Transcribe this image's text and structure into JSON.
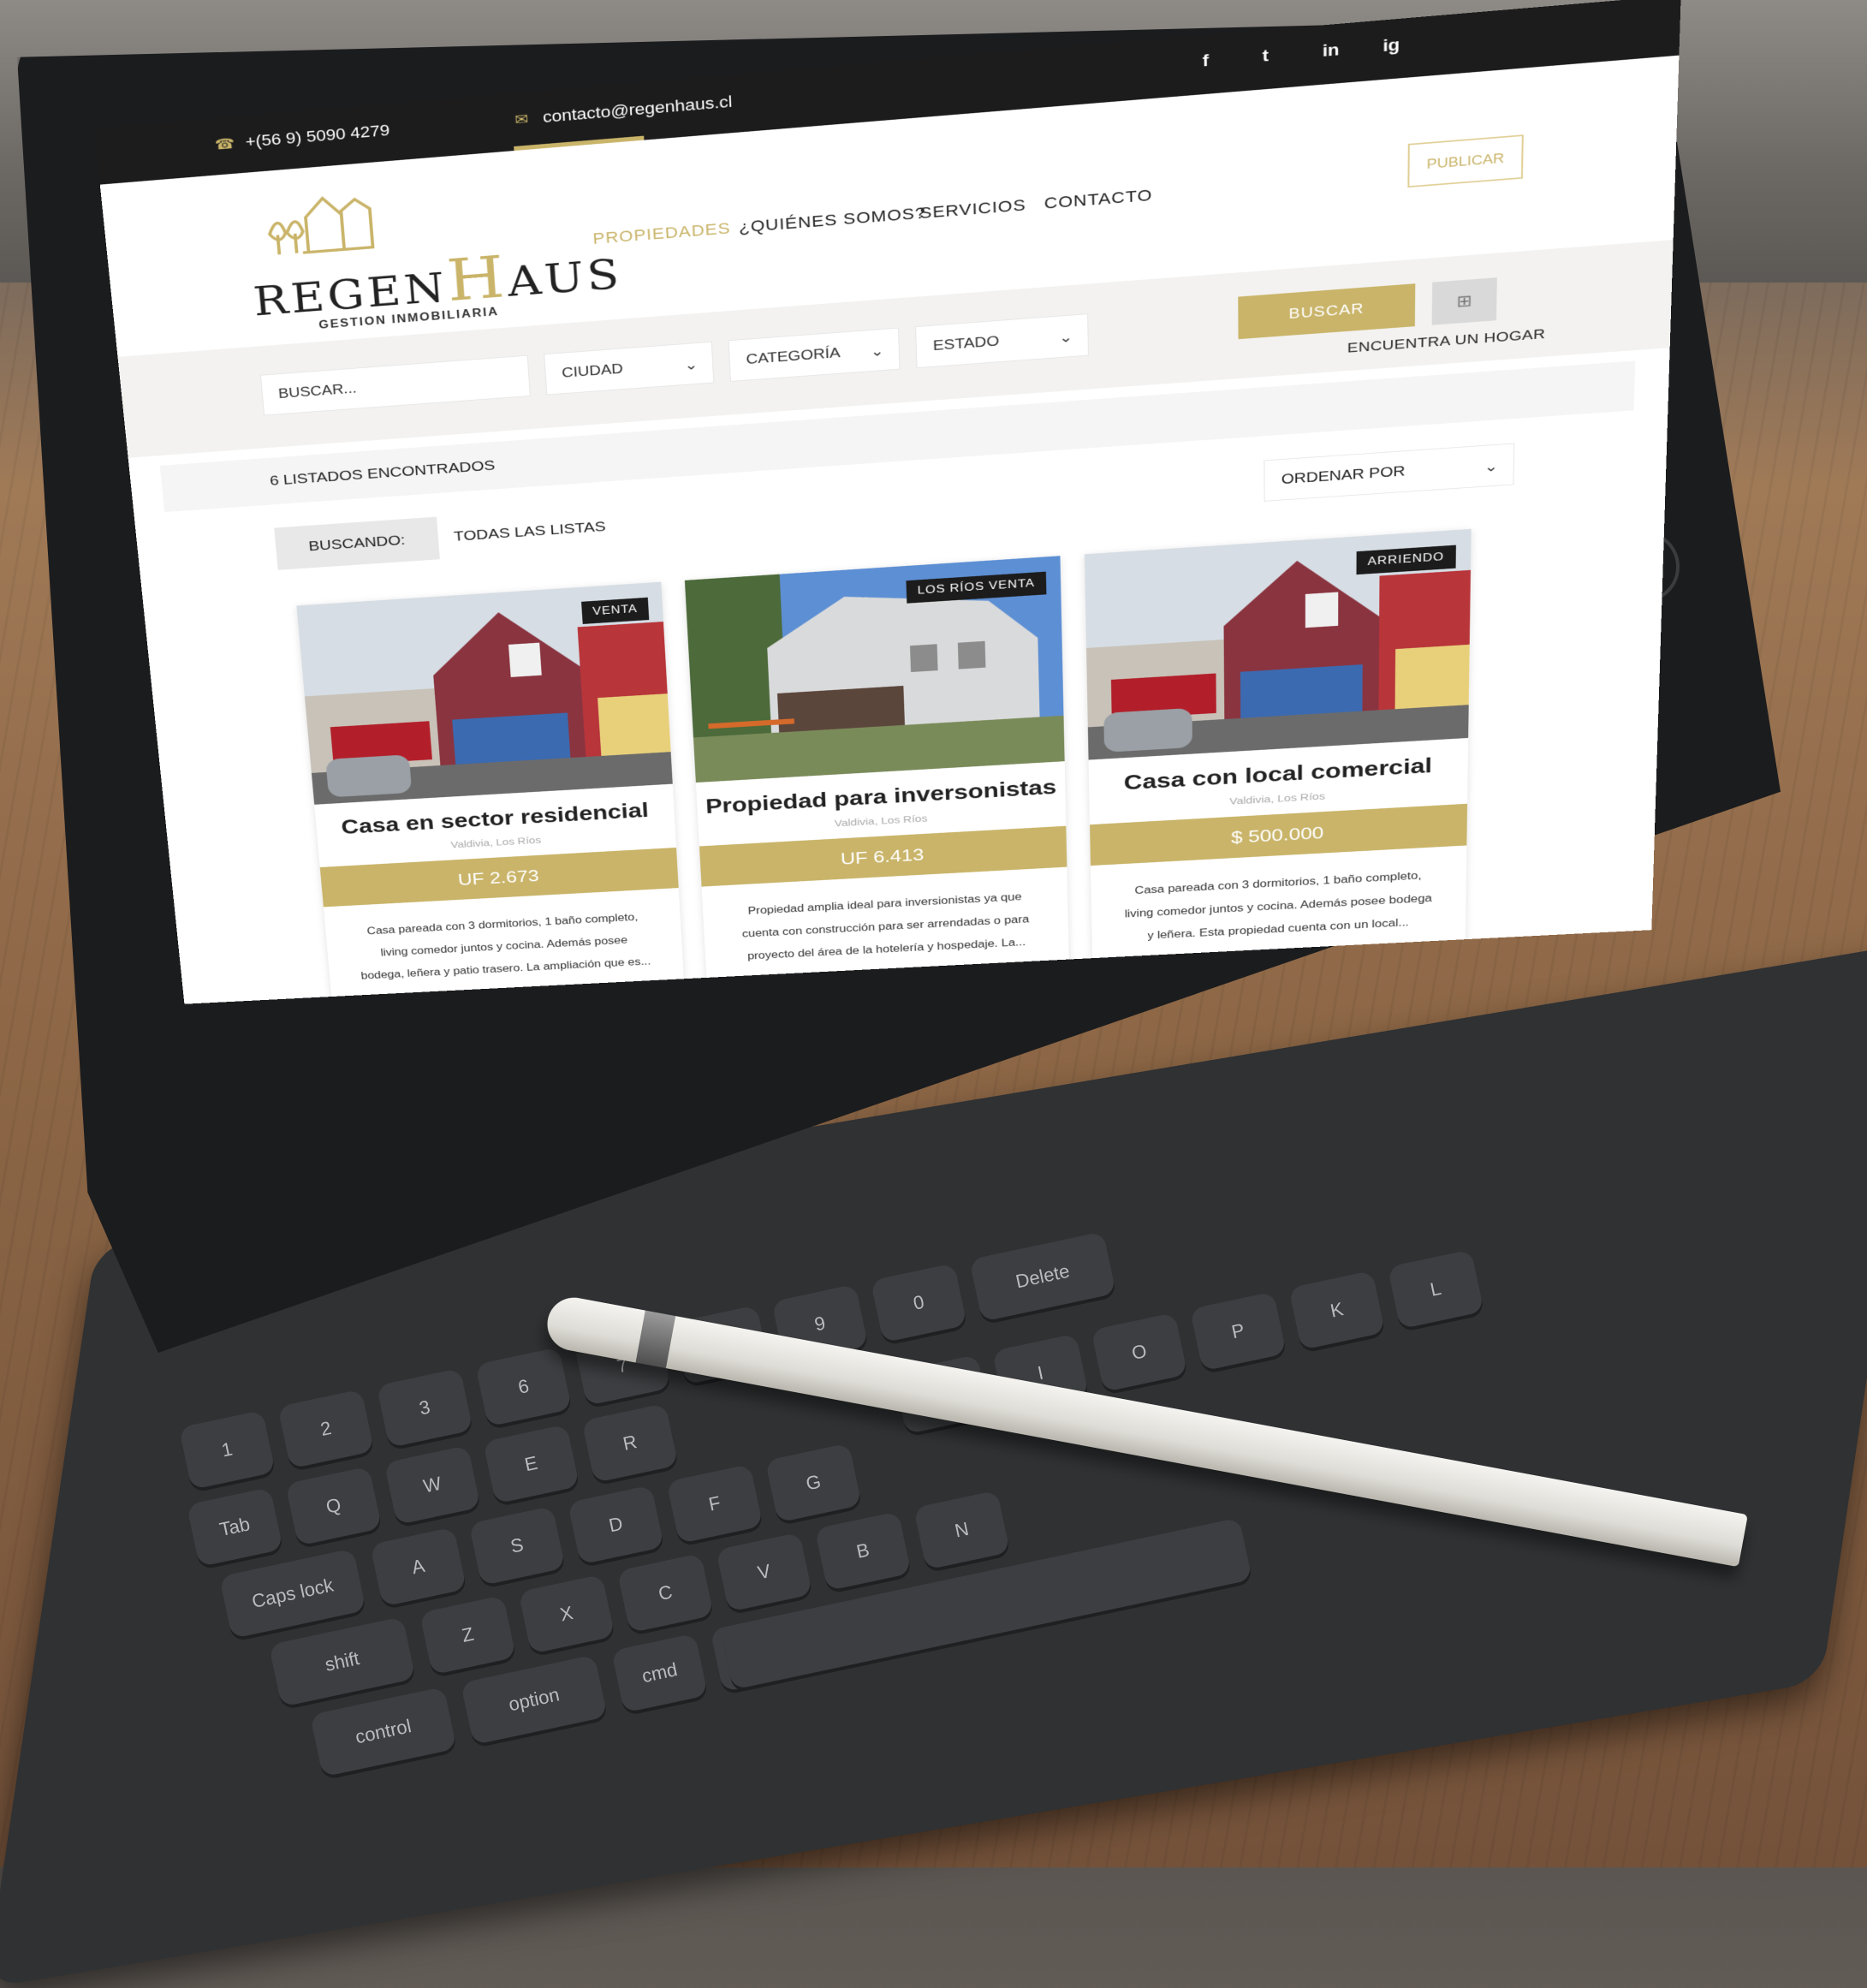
{
  "topbar": {
    "phone": "+(56 9) 5090 4279",
    "email": "contacto@regenhaus.cl",
    "social": [
      "f",
      "t",
      "in",
      "ig"
    ]
  },
  "logo": {
    "text_left": "REGEN",
    "text_h": "H",
    "text_right": "AUS",
    "subtitle": "GESTION INMOBILIARIA"
  },
  "nav": {
    "items": [
      "PROPIEDADES",
      "¿QUIÉNES SOMOS?",
      "SERVICIOS",
      "CONTACTO"
    ],
    "active_index": 0,
    "publish_label": "PUBLICAR"
  },
  "search": {
    "placeholder": "BUSCAR...",
    "city_label": "CIUDAD",
    "category_label": "CATEGORÍA",
    "status_label": "ESTADO",
    "button_label": "BUSCAR",
    "tagline": "ENCUENTRA UN HOGAR"
  },
  "results": {
    "count_label": "6 LISTADOS ENCONTRADOS",
    "searching_label": "BUSCANDO:",
    "searching_value": "TODAS LAS LISTAS",
    "sort_label": "ORDENAR POR"
  },
  "listings": [
    {
      "badge": "VENTA",
      "title": "Casa en sector residencial",
      "location": "Valdivia, Los Ríos",
      "price": "UF 2.673",
      "description": "Casa pareada con 3 dormitorios, 1 baño completo, living comedor juntos y cocina. Además posee bodega, leñera y patio trasero. La ampliación que es..."
    },
    {
      "badge": "LOS RÍOS VENTA",
      "title": "Propiedad para inversonistas",
      "location": "Valdivia, Los Ríos",
      "price": "UF 6.413",
      "description": "Propiedad amplia ideal para inversionistas ya que cuenta con construcción para ser arrendadas o para proyecto del área de la hotelería y hospedaje. La..."
    },
    {
      "badge": "ARRIENDO",
      "title": "Casa con local comercial",
      "location": "Valdivia, Los Ríos",
      "price": "$ 500.000",
      "description": "Casa pareada con 3 dormitorios, 1 baño completo, living comedor juntos y cocina. Además posee bodega y leñera. Esta propiedad cuenta con un local..."
    }
  ],
  "keyboard": {
    "keys": [
      "Tab",
      "Q",
      "W",
      "E",
      "R",
      "Caps lock",
      "A",
      "S",
      "D",
      "F",
      "G",
      "shift",
      "Z",
      "X",
      "C",
      "V",
      "B",
      "N",
      "control",
      "option",
      "cmd",
      "cmd",
      "1",
      "2",
      "3",
      "6",
      "7",
      "8",
      "9",
      "0",
      "Delete",
      "U",
      "I",
      "O",
      "P",
      "K",
      "L"
    ]
  },
  "colors": {
    "accent": "#c9b469",
    "topbar": "#1c1c1c",
    "badge": "#1c1c1c"
  }
}
